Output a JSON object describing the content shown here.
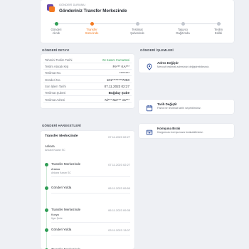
{
  "status": {
    "kicker": "GÖNDERİ DURUMU",
    "headline": "Gönderiniz Transfer Merkezinde",
    "steps": [
      {
        "l1": "Gönderi",
        "l2": "Alındı",
        "state": "done"
      },
      {
        "l1": "Transfer",
        "l2": "Sürecinde",
        "state": "active"
      },
      {
        "l1": "Teslimat",
        "l2": "Şubesinde",
        "state": "pending"
      },
      {
        "l1": "Taşıyıcı",
        "l2": "Dağıtımda",
        "state": "pending"
      },
      {
        "l1": "Teslim",
        "l2": "Edildi",
        "state": "pending"
      }
    ],
    "colors": {
      "done": "#2f9d55",
      "active": "#f37a22",
      "pending": "#c2c7cf"
    }
  },
  "detail": {
    "title": "GÖNDERİ DETAYI",
    "rows": [
      {
        "k": "Tahmini Teslim Tarihi",
        "v": "04 Kasım Cumartesi"
      },
      {
        "k": "Teslim Alacak Kişi",
        "v": "Fe*** KA***"
      },
      {
        "k": "Teslimat No.",
        "v": "********"
      },
      {
        "k": "Gönderi No.",
        "v": "101********7250"
      },
      {
        "k": "Son İşlem Tarihi",
        "v": "07.11.2023 02:27"
      },
      {
        "k": "Teslimat Şubesi",
        "v": "Buğday Şube"
      },
      {
        "k": "Teslimat Adresi",
        "v": "Ni*** Ma*** Va***"
      }
    ]
  },
  "operations": {
    "title": "GÖNDERİ İŞLEMLERİ",
    "items": [
      {
        "title": "Adres Değiştir",
        "sub": "Mevcut teslimat adresinizi değiştirebilirsiniz.",
        "icon": "map-pin-icon"
      },
      {
        "title": "Tarih Değiştir",
        "sub": "Farklı bir teslimat tarihi seçebilirsiniz.",
        "icon": "calendar-icon"
      },
      {
        "title": "Komşuna Bırak",
        "sub": "Kargonuzu komşunuza bırakabilirsiniz.",
        "icon": "package-icon"
      }
    ]
  },
  "moves": {
    "title": "GÖNDERİ HAREKETLERİ",
    "head_title": "Transfer Merkezinde",
    "head_date": "07.11.2023 02:27",
    "head_loc": "Ankara",
    "head_sub": "Ankara Kazan SC",
    "events": [
      {
        "t": "Transfer Merkezinde",
        "d": "07.11.2023 02:27",
        "l1": "Ankara",
        "l2": "Ankara Kazan SC"
      },
      {
        "t": "Gönderi Yolda",
        "d": "06.11.2023 09:50",
        "l1": "",
        "l2": ""
      },
      {
        "t": "Transfer Merkezinde",
        "d": "06.11.2023 09:35",
        "l1": "Konya",
        "l2": "Ilgın Şube"
      },
      {
        "t": "Gönderi Yolda",
        "d": "03.11.2023 13:07",
        "l1": "",
        "l2": ""
      },
      {
        "t": "Transfer Merkezinde",
        "d": "",
        "l1": "",
        "l2": ""
      }
    ]
  }
}
